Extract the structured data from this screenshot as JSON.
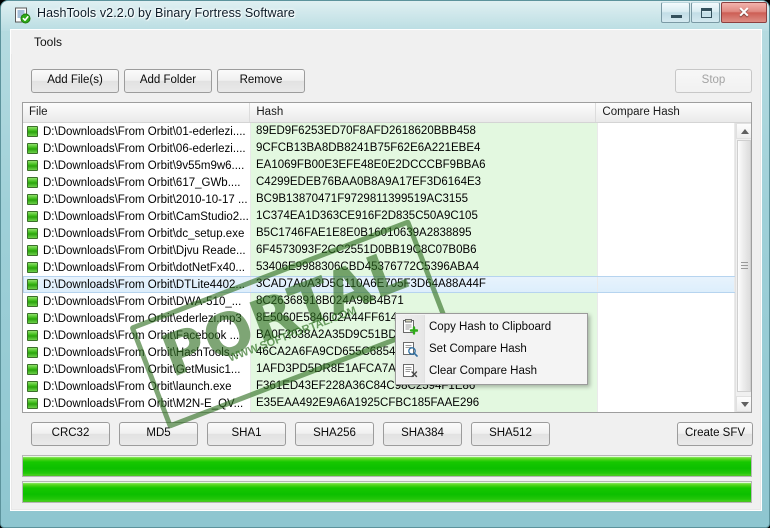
{
  "window": {
    "title": "HashTools v2.2.0 by Binary Fortress Software",
    "app_icon": "hashtools-document-check-icon",
    "buttons": {
      "minimize": "minimize-icon",
      "maximize": "maximize-icon",
      "close": "✕"
    }
  },
  "menubar": {
    "items": [
      {
        "label": "Tools"
      }
    ]
  },
  "toolbar": {
    "add_files": "Add File(s)",
    "add_folder": "Add Folder",
    "remove": "Remove",
    "stop": "Stop",
    "stop_enabled": false
  },
  "listview": {
    "columns": [
      {
        "key": "file",
        "label": "File"
      },
      {
        "key": "hash",
        "label": "Hash"
      },
      {
        "key": "compare",
        "label": "Compare Hash"
      }
    ],
    "selected_index": 9,
    "rows": [
      {
        "file": "D:\\Downloads\\From Orbit\\01-ederlezi....",
        "hash": "89ED9F6253ED70F8AFD2618620BBB458",
        "compare": ""
      },
      {
        "file": "D:\\Downloads\\From Orbit\\06-ederlezi....",
        "hash": "9CFCB13BA8DB8241B75F62E6A221EBE4",
        "compare": ""
      },
      {
        "file": "D:\\Downloads\\From Orbit\\9v55m9w6....",
        "hash": "EA1069FB00E3EFE48E0E2DCCCBF9BBA6",
        "compare": ""
      },
      {
        "file": "D:\\Downloads\\From Orbit\\617_GWb....",
        "hash": "C4299EDEB76BAA0B8A9A17EF3D6164E3",
        "compare": ""
      },
      {
        "file": "D:\\Downloads\\From Orbit\\2010-10-17 ...",
        "hash": "BC9B13870471F9729811399519AC3155",
        "compare": ""
      },
      {
        "file": "D:\\Downloads\\From Orbit\\CamStudio2...",
        "hash": "1C374EA1D363CE916F2D835C50A9C105",
        "compare": ""
      },
      {
        "file": "D:\\Downloads\\From Orbit\\dc_setup.exe",
        "hash": "B5C1746FAE1E8E0B16010639A2838895",
        "compare": ""
      },
      {
        "file": "D:\\Downloads\\From Orbit\\Djvu Reade...",
        "hash": "6F4573093F2CC2551D0BB19C8C07B0B6",
        "compare": ""
      },
      {
        "file": "D:\\Downloads\\From Orbit\\dotNetFx40...",
        "hash": "53406E9988306CBD45376772C5396ABA4",
        "compare": ""
      },
      {
        "file": "D:\\Downloads\\From Orbit\\DTLite4402...",
        "hash": "3CAD7A0A3D5C110A6E705F3D64A88A44F",
        "compare": ""
      },
      {
        "file": "D:\\Downloads\\From Orbit\\DWA-510_...",
        "hash": "8C26368918B024A98B4B71",
        "compare": ""
      },
      {
        "file": "D:\\Downloads\\From Orbit\\ederlezi.mp3",
        "hash": "8E5060E5846D2A44FF614",
        "compare": ""
      },
      {
        "file": "D:\\Downloads\\From Orbit\\Facebook ...",
        "hash": "BA0F2038A2A35D9C51BD",
        "compare": ""
      },
      {
        "file": "D:\\Downloads\\From Orbit\\HashTools...",
        "hash": "46CA2A6FA9CD655C685438FE57B8AAE4",
        "compare": ""
      },
      {
        "file": "D:\\Downloads\\From Orbit\\GetMusic1...",
        "hash": "1AFD3PD5DR8E1AFCA7A405183D5F761A",
        "compare": ""
      },
      {
        "file": "D:\\Downloads\\From Orbit\\launch.exe",
        "hash": "F361ED43EF228A36C84C98C2594F1E86",
        "compare": ""
      },
      {
        "file": "D:\\Downloads\\From Orbit\\M2N-E_QV...",
        "hash": "E35EAA492E9A6A1925CFBC185FAAE296",
        "compare": ""
      }
    ]
  },
  "context_menu": {
    "items": [
      {
        "label": "Copy Hash to Clipboard",
        "icon": "copy-clipboard-icon"
      },
      {
        "label": "Set Compare Hash",
        "icon": "set-compare-icon"
      },
      {
        "label": "Clear Compare Hash",
        "icon": "clear-compare-icon"
      }
    ]
  },
  "hash_buttons": [
    {
      "label": "CRC32"
    },
    {
      "label": "MD5"
    },
    {
      "label": "SHA1"
    },
    {
      "label": "SHA256"
    },
    {
      "label": "SHA384"
    },
    {
      "label": "SHA512"
    }
  ],
  "create_sfv": {
    "label": "Create SFV"
  },
  "progress": {
    "bar1_percent": 100,
    "bar2_percent": 100
  },
  "watermark": {
    "stamp_text": "PORTAL",
    "url_text": "WWW.SOFTPORTAL.COM"
  },
  "colors": {
    "accent_green": "#16c800",
    "hash_cell_bg": "#e3f8e0",
    "selection_blue": "#dceefb",
    "window_chrome": "#9fd0d8",
    "close_button_red": "#cd5f55"
  }
}
